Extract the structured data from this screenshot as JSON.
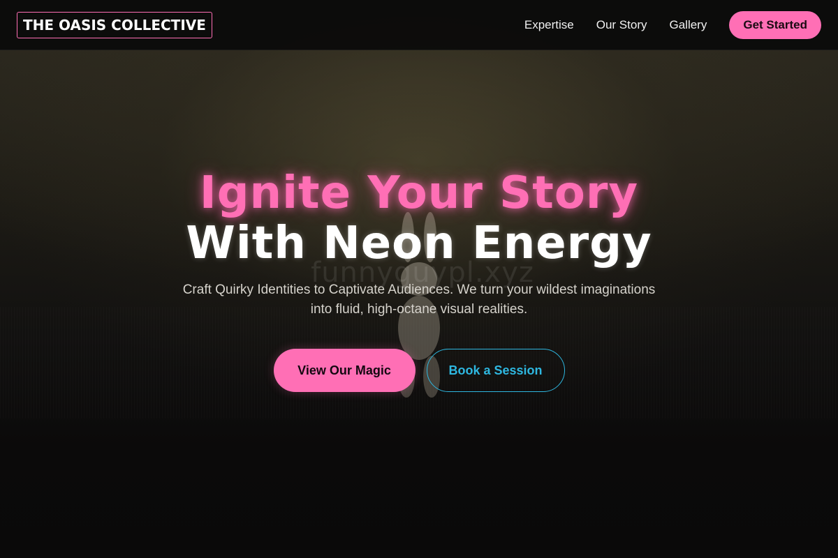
{
  "header": {
    "logo_text": "THE OASIS COLLECTIVE",
    "nav": [
      {
        "label": "Expertise"
      },
      {
        "label": "Our Story"
      },
      {
        "label": "Gallery"
      }
    ],
    "cta_label": "Get Started"
  },
  "hero": {
    "headline_line1": "Ignite Your Story",
    "headline_line2": "With Neon Energy",
    "subtitle": "Craft Quirky Identities to Captivate Audiences. We turn your wildest imaginations into fluid, high-octane visual realities.",
    "primary_button": "View Our Magic",
    "secondary_button": "Book a Session",
    "watermark": "funnyguypl.xyz"
  },
  "colors": {
    "accent_pink": "#ff6fb5",
    "accent_cyan": "#2eb7e0",
    "header_bg": "#0a0a0a",
    "text_light": "#ffffff"
  },
  "icons": {
    "background_figure": "bunny-figure"
  }
}
